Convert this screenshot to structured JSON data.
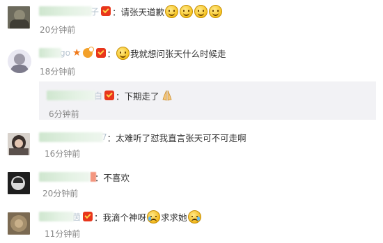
{
  "comments": [
    {
      "name_tail": "子",
      "text": "：请张天道歉",
      "time": "20分钟前"
    },
    {
      "name_tail": "go",
      "text": "我就想问张天什么时候走",
      "time": "18分钟前",
      "reply": {
        "name_tail": "白",
        "text": "：下期走了",
        "time": "6分钟前"
      }
    },
    {
      "name_tail": "7",
      "text": "：太难听了怼我直言张天可不可走啊",
      "time": "16分钟前"
    },
    {
      "name_tail": "",
      "text": "：不喜欢",
      "time": "20分钟前"
    },
    {
      "name_tail": "茵",
      "text": "：我滴个神呀",
      "text2": "求求她",
      "time": "11分钟前"
    }
  ],
  "icons": {
    "badge": "red-vip-badge-icon",
    "smile": "smile-emoji-icon",
    "cry": "cry-emoji-icon",
    "hands": "praying-hands-emoji-icon",
    "star": "star-icon"
  },
  "colors": {
    "badge": "#e8361c",
    "time": "#888888",
    "reply_bg": "#f2f2f5",
    "star": "#f07a1a"
  }
}
